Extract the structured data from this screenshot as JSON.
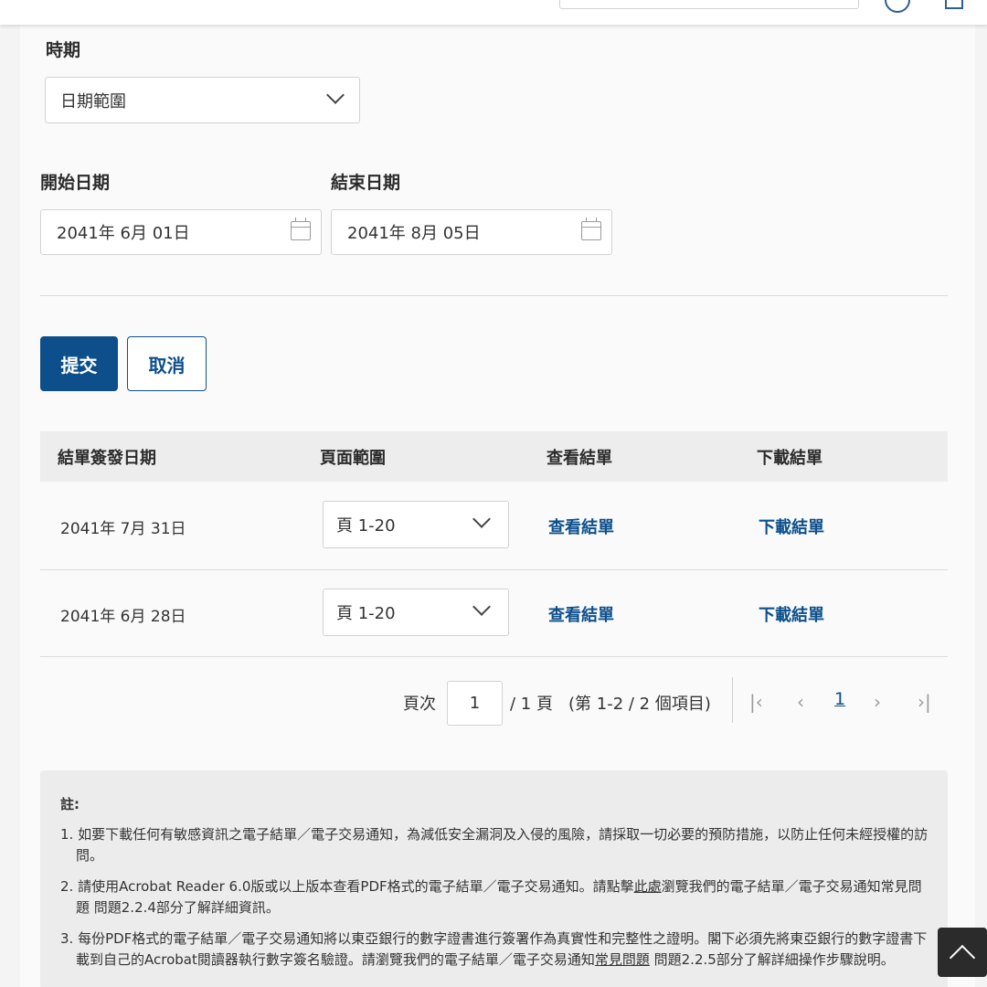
{
  "period": {
    "label": "時期",
    "selected": "日期範圍"
  },
  "dates": {
    "start_label": "開始日期",
    "start_value": "2041年 6月 01日",
    "end_label": "結束日期",
    "end_value": "2041年 8月 05日"
  },
  "actions": {
    "submit": "提交",
    "cancel": "取消"
  },
  "table": {
    "headers": [
      "結單簽發日期",
      "頁面範圍",
      "查看結單",
      "下載結單"
    ],
    "rows": [
      {
        "date": "2041年 7月 31日",
        "page_range": "頁 1-20",
        "view": "查看結單",
        "download": "下載結單"
      },
      {
        "date": "2041年 6月 28日",
        "page_range": "頁 1-20",
        "view": "查看結單",
        "download": "下載結單"
      }
    ]
  },
  "pagination": {
    "page_label": "頁次",
    "page_value": "1",
    "total_text": "/ 1 頁",
    "items_text": "(第 1-2 / 2 個項目)",
    "current_page": "1",
    "icons": [
      "first-page-icon",
      "prev-page-icon",
      "next-page-icon",
      "last-page-icon"
    ]
  },
  "notes": {
    "title": "註:",
    "item1": "1. 如要下載任何有敏感資訊之電子結單／電子交易通知，為減低安全漏洞及入侵的風險，請採取一切必要的預防措施，以防止任何未經授權的訪問。",
    "item2_before": "2. 請使用Acrobat Reader 6.0版或以上版本查看PDF格式的電子結單／電子交易通知。請點擊",
    "item2_link": "此處",
    "item2_after": "瀏覽我們的電子結單／電子交易通知常見問題 問題2.2.4部分了解詳細資訊。",
    "item3_before": "3. 每份PDF格式的電子結單／電子交易通知將以東亞銀行的數字證書進行簽署作為真實性和完整性之證明。閣下必須先將東亞銀行的數字證書下載到自己的Acrobat閱讀器執行數字簽名驗證。請瀏覽我們的電子結單／電子交易通知",
    "item3_link": "常見問題",
    "item3_after": " 問題2.2.5部分了解詳細操作步驟說明。"
  },
  "colors": {
    "primary": "#0d4f8b",
    "background": "#f4f4f4",
    "header_row": "#ededed"
  }
}
